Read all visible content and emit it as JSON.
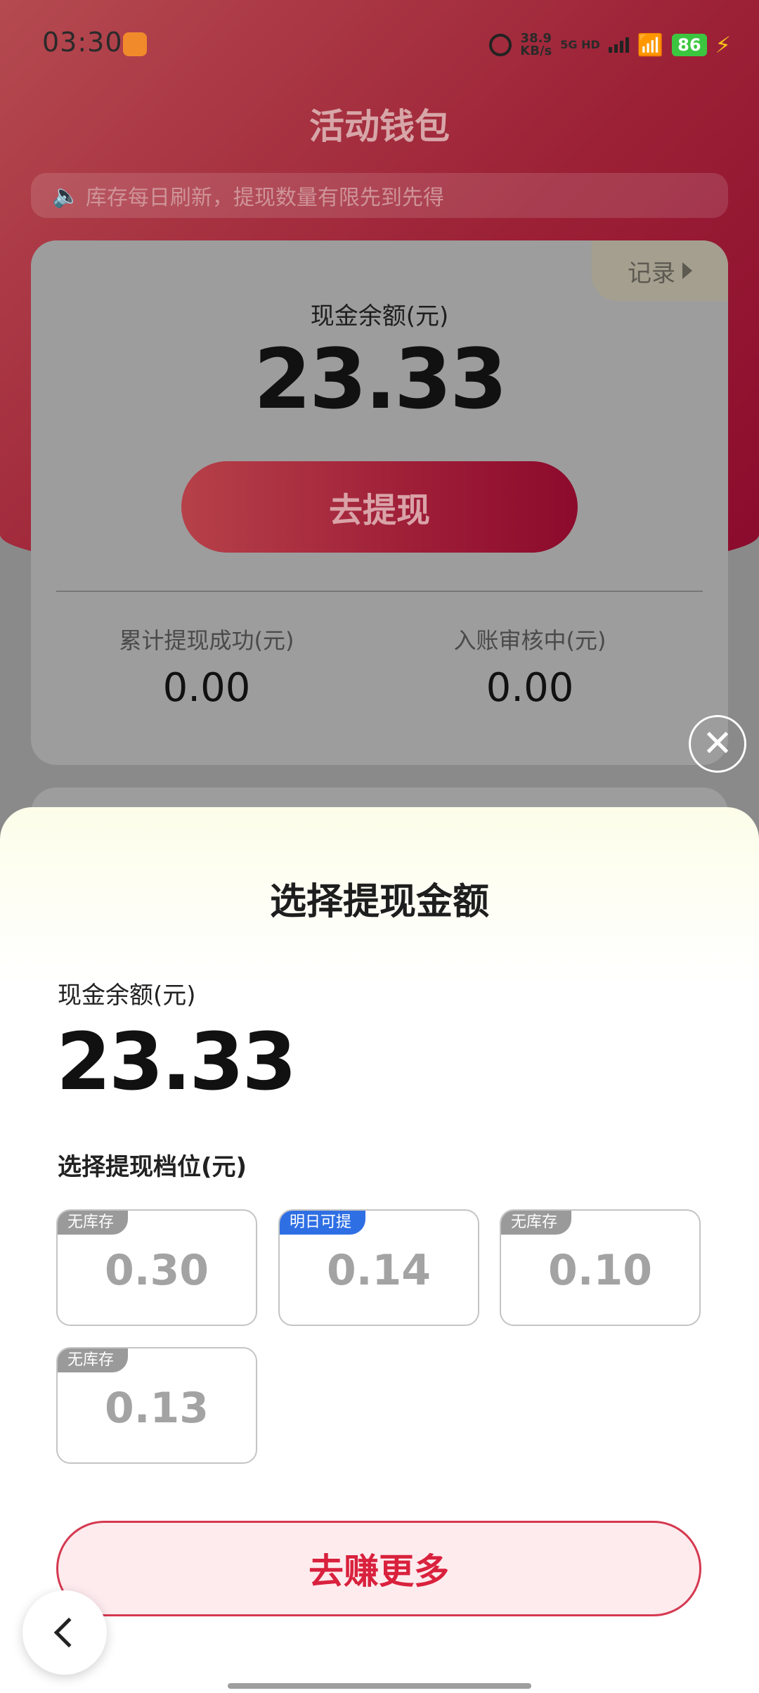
{
  "status_bar": {
    "time": "03:30",
    "net_speed_value": "38.9",
    "net_speed_unit": "KB/s",
    "network": "5G HD",
    "battery": "86"
  },
  "header": {
    "title": "活动钱包",
    "notice": "库存每日刷新，提现数量有限先到先得"
  },
  "wallet_card": {
    "record_label": "记录",
    "balance_label": "现金余额(元)",
    "balance": "23.33",
    "withdraw_button": "去提现",
    "total_success_label": "累计提现成功(元)",
    "total_success_value": "0.00",
    "pending_label": "入账审核中(元)",
    "pending_value": "0.00"
  },
  "sheet": {
    "title": "选择提现金额",
    "balance_label": "现金余额(元)",
    "balance": "23.33",
    "tier_label": "选择提现档位(元)",
    "tiers": [
      {
        "badge": "无库存",
        "value": "0.30",
        "badge_color": "#9a9a9a"
      },
      {
        "badge": "明日可提",
        "value": "0.14",
        "badge_color": "#2f6fe4"
      },
      {
        "badge": "无库存",
        "value": "0.10",
        "badge_color": "#9a9a9a"
      },
      {
        "badge": "无库存",
        "value": "0.13",
        "badge_color": "#9a9a9a"
      }
    ],
    "earn_more_button": "去赚更多"
  },
  "colors": {
    "accent_red": "#d9213d",
    "hero_red": "#9c2136"
  }
}
